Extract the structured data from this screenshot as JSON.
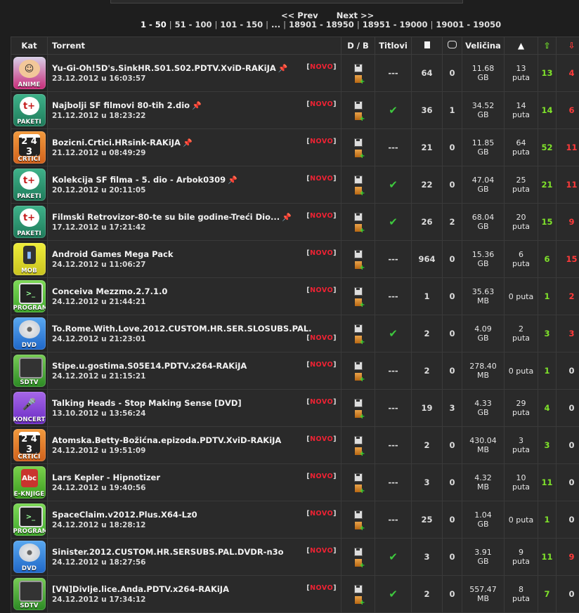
{
  "pager": {
    "prev": "<< Prev",
    "next": "Next >>",
    "pages": [
      "1 - 50",
      "51 - 100",
      "101 - 150",
      "...",
      "18901 - 18950",
      "18951 - 19000",
      "19001 - 19050"
    ]
  },
  "headers": {
    "kat": "Kat",
    "torrent": "Torrent",
    "db": "D / B",
    "titlovi": "Titlovi",
    "velicina": "Veličina"
  },
  "icons": {
    "files": "file-icon",
    "comments": "comment-icon",
    "completed": "home-icon",
    "seeders": "arrow-up-icon",
    "leechers": "arrow-down-icon"
  },
  "rows": [
    {
      "cat": "ANIME",
      "catclass": "cat-anime",
      "glyph": "☺",
      "name": "Yu-Gi-Oh!5D's.SinkHR.S01.S02.PDTV.XviD-RAKiJA",
      "pin": true,
      "date": "23.12.2012 u 16:03:57",
      "novo": "NOVO",
      "subs": "---",
      "files": "64",
      "comments": "0",
      "size1": "11.68",
      "size2": "GB",
      "done1": "13",
      "done2": "puta",
      "seed": "13",
      "leech": "4"
    },
    {
      "cat": "PAKETI",
      "catclass": "cat-paketi",
      "glyph": "t+",
      "name": "Najbolji SF filmovi 80-tih 2.dio",
      "pin": true,
      "date": "21.12.2012 u 18:23:22",
      "novo": "NOVO",
      "subs": "check",
      "files": "36",
      "comments": "1",
      "size1": "34.52",
      "size2": "GB",
      "done1": "14",
      "done2": "puta",
      "seed": "14",
      "leech": "6"
    },
    {
      "cat": "CRTIĆI",
      "catclass": "cat-crtici",
      "glyph": "2 4 3",
      "name": "Bozicni.Crtici.HRsink-RAKiJA",
      "pin": true,
      "date": "21.12.2012 u 08:49:29",
      "novo": "NOVO",
      "subs": "---",
      "files": "21",
      "comments": "0",
      "size1": "11.85",
      "size2": "GB",
      "done1": "64",
      "done2": "puta",
      "seed": "52",
      "leech": "11"
    },
    {
      "cat": "PAKETI",
      "catclass": "cat-paketi",
      "glyph": "t+",
      "name": "Kolekcija SF filma - 5. dio - Arbok0309",
      "pin": true,
      "date": "20.12.2012 u 20:11:05",
      "novo": "NOVO",
      "subs": "check",
      "files": "22",
      "comments": "0",
      "size1": "47.04",
      "size2": "GB",
      "done1": "25",
      "done2": "puta",
      "seed": "21",
      "leech": "11"
    },
    {
      "cat": "PAKETI",
      "catclass": "cat-paketi",
      "glyph": "t+",
      "name": "Filmski Retrovizor-80-te su bile godine-Treći Dio...",
      "pin": true,
      "date": "17.12.2012 u 17:21:42",
      "novo": "NOVO",
      "subs": "check",
      "files": "26",
      "comments": "2",
      "size1": "68.04",
      "size2": "GB",
      "done1": "20",
      "done2": "puta",
      "seed": "15",
      "leech": "9"
    },
    {
      "cat": "MOB",
      "catclass": "cat-mob",
      "glyph": "▮",
      "name": "Android Games Mega Pack",
      "pin": false,
      "date": "24.12.2012 u 11:06:27",
      "novo": "NOVO",
      "subs": "---",
      "files": "964",
      "comments": "0",
      "size1": "15.36",
      "size2": "GB",
      "done1": "6",
      "done2": "puta",
      "seed": "6",
      "leech": "15"
    },
    {
      "cat": "PROGRAMI",
      "catclass": "cat-programi",
      "glyph": ">_",
      "name": "Conceiva Mezzmo.2.7.1.0",
      "pin": false,
      "date": "24.12.2012 u 21:44:21",
      "novo": "NOVO",
      "subs": "---",
      "files": "1",
      "comments": "0",
      "size1": "35.63",
      "size2": "MB",
      "done1": "0 puta",
      "done2": "",
      "seed": "1",
      "leech": "2"
    },
    {
      "cat": "DVD",
      "catclass": "cat-dvd",
      "glyph": "",
      "name": "To.Rome.With.Love.2012.CUSTOM.HR.SER.SLOSUBS.PAL....",
      "pin": false,
      "date": "24.12.2012 u 21:23:01",
      "novo": "NOVO",
      "novolow": true,
      "subs": "check",
      "files": "2",
      "comments": "0",
      "size1": "4.09",
      "size2": "GB",
      "done1": "2",
      "done2": "puta",
      "seed": "3",
      "leech": "3"
    },
    {
      "cat": "SDTV",
      "catclass": "cat-sdtv",
      "glyph": "",
      "name": "Stipe.u.gostima.S05E14.PDTV.x264-RAKiJA",
      "pin": false,
      "date": "24.12.2012 u 21:15:21",
      "novo": "NOVO",
      "subs": "---",
      "files": "2",
      "comments": "0",
      "size1": "278.40",
      "size2": "MB",
      "done1": "0 puta",
      "done2": "",
      "seed": "1",
      "leech": "0"
    },
    {
      "cat": "KONCERTI",
      "catclass": "cat-koncerti",
      "glyph": "🎤",
      "name": "Talking Heads - Stop Making Sense [DVD]",
      "pin": false,
      "date": "13.10.2012 u 13:56:24",
      "novo": "NOVO",
      "subs": "---",
      "files": "19",
      "comments": "3",
      "size1": "4.33",
      "size2": "GB",
      "done1": "29",
      "done2": "puta",
      "seed": "4",
      "leech": "0"
    },
    {
      "cat": "CRTIĆI",
      "catclass": "cat-crtici",
      "glyph": "2 4 3",
      "name": "Atomska.Betty-Božićna.epizoda.PDTV.XviD-RAKiJA",
      "pin": false,
      "date": "24.12.2012 u 19:51:09",
      "novo": "NOVO",
      "subs": "---",
      "files": "2",
      "comments": "0",
      "size1": "430.04",
      "size2": "MB",
      "done1": "3",
      "done2": "puta",
      "seed": "3",
      "leech": "0"
    },
    {
      "cat": "E-KNJIGE",
      "catclass": "cat-eknjige",
      "glyph": "Abc",
      "name": "Lars Kepler - Hipnotizer",
      "pin": false,
      "date": "24.12.2012 u 19:40:56",
      "novo": "NOVO",
      "subs": "---",
      "files": "3",
      "comments": "0",
      "size1": "4.32",
      "size2": "MB",
      "done1": "10",
      "done2": "puta",
      "seed": "11",
      "leech": "0"
    },
    {
      "cat": "PROGRAMI",
      "catclass": "cat-programi",
      "glyph": ">_",
      "name": "SpaceClaim.v2012.Plus.X64-Lz0",
      "pin": false,
      "date": "24.12.2012 u 18:28:12",
      "novo": "NOVO",
      "subs": "---",
      "files": "25",
      "comments": "0",
      "size1": "1.04",
      "size2": "GB",
      "done1": "0 puta",
      "done2": "",
      "seed": "1",
      "leech": "0"
    },
    {
      "cat": "DVD",
      "catclass": "cat-dvd",
      "glyph": "",
      "name": "Sinister.2012.CUSTOM.HR.SERSUBS.PAL.DVDR-n3o",
      "pin": false,
      "date": "24.12.2012 u 18:27:56",
      "novo": "NOVO",
      "subs": "check",
      "files": "3",
      "comments": "0",
      "size1": "3.91",
      "size2": "GB",
      "done1": "9",
      "done2": "puta",
      "seed": "11",
      "leech": "9"
    },
    {
      "cat": "SDTV",
      "catclass": "cat-sdtv",
      "glyph": "",
      "name": "[VN]Divlje.lice.Anda.PDTV.x264-RAKiJA",
      "pin": false,
      "date": "24.12.2012 u 17:34:12",
      "novo": "NOVO",
      "subs": "check",
      "files": "2",
      "comments": "0",
      "size1": "557.47",
      "size2": "MB",
      "done1": "8",
      "done2": "puta",
      "seed": "7",
      "leech": "0"
    }
  ]
}
